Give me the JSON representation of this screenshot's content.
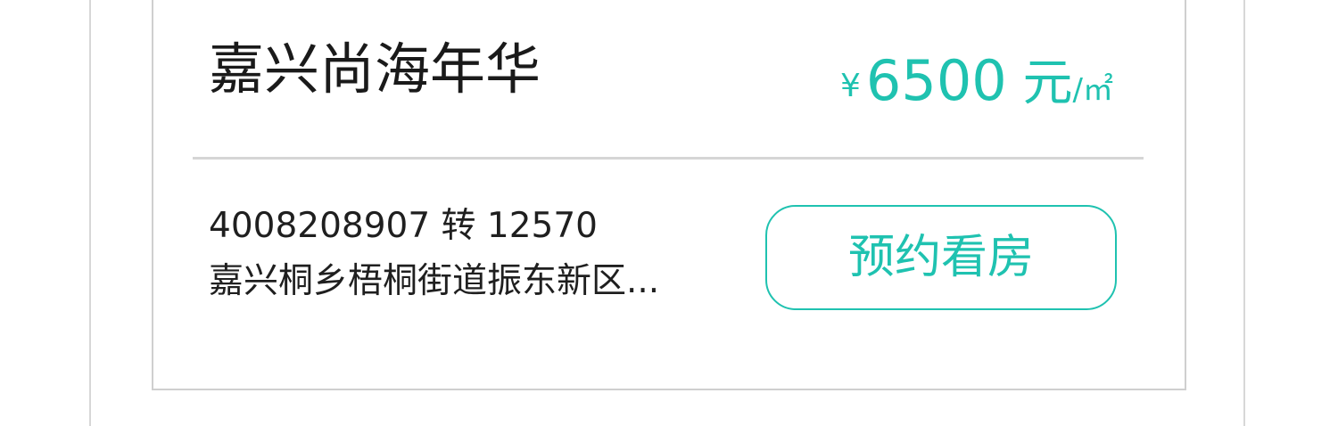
{
  "listing": {
    "title": "嘉兴尚海年华",
    "price": {
      "currency_symbol": "¥",
      "amount": "6500",
      "unit": " 元",
      "per": "/㎡"
    },
    "phone": "4008208907 转 12570",
    "address": "嘉兴桐乡梧桐街道振东新区...",
    "book_button_label": "预约看房"
  },
  "colors": {
    "accent": "#1fc2b0",
    "text": "#1a1a1a",
    "divider": "#d5d5d5",
    "border": "#cfcfcf"
  }
}
